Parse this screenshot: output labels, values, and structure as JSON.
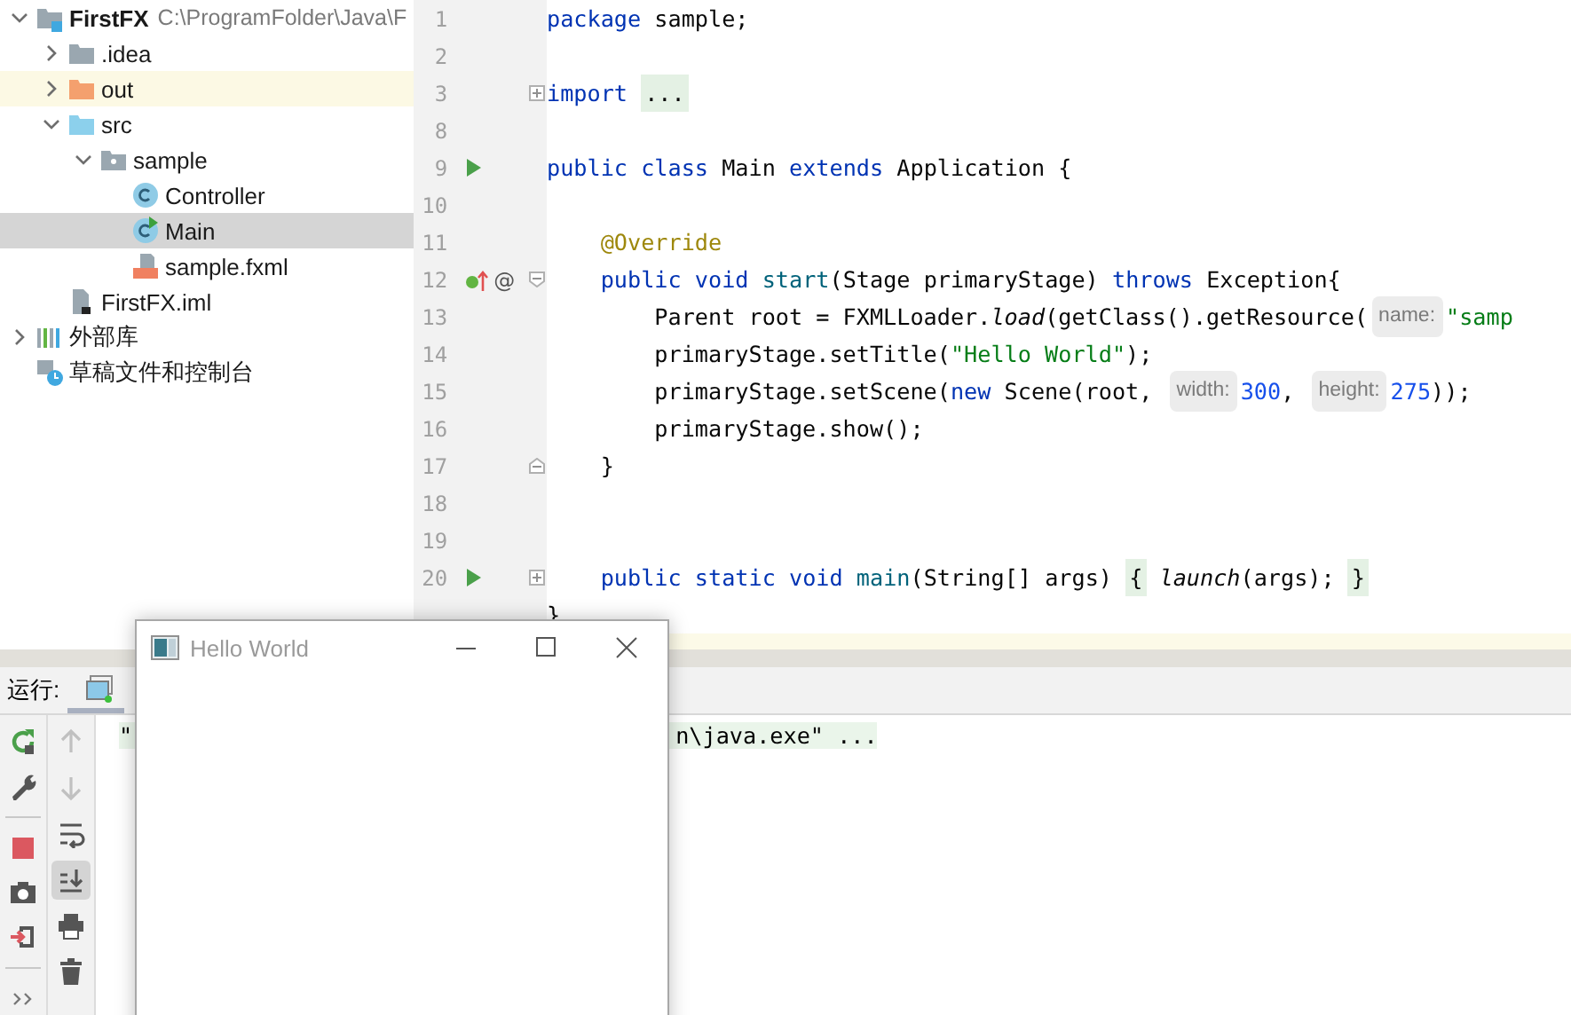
{
  "project_tree": [
    {
      "label": "FirstFX",
      "path": "C:\\ProgramFolder\\Java\\F",
      "kind": "module",
      "expanded": true,
      "selected": false,
      "highlighted": false,
      "children": [
        {
          "label": ".idea",
          "kind": "folder",
          "expanded": false,
          "selected": false,
          "highlighted": false
        },
        {
          "label": "out",
          "kind": "excluded-folder",
          "expanded": false,
          "selected": false,
          "highlighted": true
        },
        {
          "label": "src",
          "kind": "source-folder",
          "expanded": true,
          "selected": false,
          "highlighted": false,
          "children": [
            {
              "label": "sample",
              "kind": "package",
              "expanded": true,
              "selected": false,
              "highlighted": false,
              "children": [
                {
                  "label": "Controller",
                  "kind": "class",
                  "selected": false,
                  "highlighted": false
                },
                {
                  "label": "Main",
                  "kind": "main-class",
                  "selected": true,
                  "highlighted": false
                },
                {
                  "label": "sample.fxml",
                  "kind": "fxml",
                  "selected": false,
                  "highlighted": false
                }
              ]
            }
          ]
        },
        {
          "label": "FirstFX.iml",
          "kind": "iml",
          "selected": false,
          "highlighted": false
        }
      ]
    },
    {
      "label": "外部库",
      "kind": "libraries",
      "expanded": false,
      "selected": false,
      "highlighted": false
    },
    {
      "label": "草稿文件和控制台",
      "kind": "scratches",
      "selected": false,
      "highlighted": false
    }
  ],
  "editor": {
    "lines": [
      {
        "number": "1",
        "tokens": [
          {
            "kind": "keyword",
            "text": "package"
          },
          {
            "kind": "plain",
            "text": " sample;"
          }
        ]
      },
      {
        "number": "2"
      },
      {
        "number": "3",
        "fold_marker": {
          "kind": "expand"
        },
        "tokens": [
          {
            "kind": "keyword",
            "text": "import "
          },
          {
            "kind": "folded",
            "text": "..."
          }
        ]
      },
      {
        "number": "8"
      },
      {
        "number": "9",
        "gutter_icon": {
          "kind": "run"
        },
        "tokens": [
          {
            "kind": "keyword",
            "text": "public"
          },
          {
            "kind": "keyword",
            "text": " class"
          },
          {
            "kind": "plain",
            "text": " Main "
          },
          {
            "kind": "keyword",
            "text": "extends"
          },
          {
            "kind": "plain",
            "text": " Application {"
          }
        ]
      },
      {
        "number": "10"
      },
      {
        "number": "11",
        "tokens": [
          {
            "kind": "annotation",
            "text": "    @Override"
          }
        ]
      },
      {
        "number": "12",
        "gutter_icon": {
          "kind": "override"
        },
        "gutter_mark": "@",
        "fold_marker": {
          "kind": "collapse"
        },
        "tokens": [
          {
            "kind": "keyword",
            "text": "    public"
          },
          {
            "kind": "keyword",
            "text": " void"
          },
          {
            "kind": "method",
            "text": " start"
          },
          {
            "kind": "plain",
            "text": "(Stage primaryStage) "
          },
          {
            "kind": "keyword",
            "text": "throws"
          },
          {
            "kind": "plain",
            "text": " Exception{"
          }
        ]
      },
      {
        "number": "13",
        "tokens": [
          {
            "kind": "plain",
            "text": "        Parent root = FXMLLoader."
          },
          {
            "kind": "italic",
            "text": "load"
          },
          {
            "kind": "plain",
            "text": "(getClass().getResource("
          },
          {
            "kind": "hint",
            "text": "name:"
          },
          {
            "kind": "string",
            "text": "\"samp"
          }
        ]
      },
      {
        "number": "14",
        "tokens": [
          {
            "kind": "plain",
            "text": "        primaryStage.setTitle("
          },
          {
            "kind": "string",
            "text": "\"Hello World\""
          },
          {
            "kind": "plain",
            "text": ");"
          }
        ]
      },
      {
        "number": "15",
        "tokens": [
          {
            "kind": "plain",
            "text": "        primaryStage.setScene("
          },
          {
            "kind": "keyword",
            "text": "new"
          },
          {
            "kind": "plain",
            "text": " Scene(root, "
          },
          {
            "kind": "hint",
            "text": "width:"
          },
          {
            "kind": "number",
            "text": "300"
          },
          {
            "kind": "plain",
            "text": ", "
          },
          {
            "kind": "hint",
            "text": "height:"
          },
          {
            "kind": "number",
            "text": "275"
          },
          {
            "kind": "plain",
            "text": "));"
          }
        ]
      },
      {
        "number": "16",
        "tokens": [
          {
            "kind": "plain",
            "text": "        primaryStage.show();"
          }
        ]
      },
      {
        "number": "17",
        "fold_marker": {
          "kind": "end"
        },
        "tokens": [
          {
            "kind": "plain",
            "text": "    }"
          }
        ]
      },
      {
        "number": "18"
      },
      {
        "number": "19"
      },
      {
        "number": "20",
        "gutter_icon": {
          "kind": "run"
        },
        "fold_marker": {
          "kind": "expand"
        },
        "tokens": [
          {
            "kind": "keyword",
            "text": "    public"
          },
          {
            "kind": "keyword",
            "text": " static"
          },
          {
            "kind": "keyword",
            "text": " void"
          },
          {
            "kind": "method",
            "text": " main"
          },
          {
            "kind": "plain",
            "text": "(String[] args) "
          },
          {
            "kind": "folded",
            "text": "{"
          },
          {
            "kind": "italic",
            "text": " launch"
          },
          {
            "kind": "plain",
            "text": "(args); "
          },
          {
            "kind": "folded",
            "text": "}"
          }
        ]
      },
      {
        "tokens": [
          {
            "kind": "plain",
            "text": "}"
          }
        ]
      }
    ]
  },
  "run_panel": {
    "label": "运行:",
    "tabs": [
      {
        "selected": true
      }
    ],
    "left_toolbar": [
      {
        "kind": "rerun"
      },
      {
        "kind": "settings"
      },
      {
        "kind": "separator"
      },
      {
        "kind": "stop"
      },
      {
        "kind": "camera"
      },
      {
        "kind": "exit"
      },
      {
        "kind": "separator"
      },
      {
        "kind": "more"
      }
    ],
    "right_toolbar": [
      {
        "kind": "up",
        "disabled": true,
        "on": false
      },
      {
        "kind": "down",
        "disabled": true,
        "on": false
      },
      {
        "kind": "wrap",
        "disabled": false,
        "on": false
      },
      {
        "kind": "scroll-end",
        "disabled": false,
        "on": true
      },
      {
        "kind": "print",
        "disabled": false,
        "on": false
      },
      {
        "kind": "delete",
        "disabled": false,
        "on": false
      }
    ],
    "console": [
      "\"",
      "n\\java.exe\" ..."
    ]
  },
  "app_window": {
    "title": "Hello World"
  }
}
